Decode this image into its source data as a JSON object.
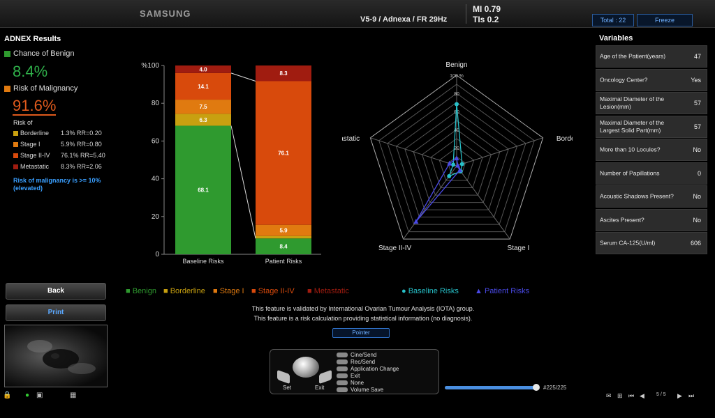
{
  "header": {
    "brand": "SAMSUNG",
    "probe": "V5-9 / Adnexa / FR 29Hz",
    "mi": "MI  0.79",
    "tis": "TIs 0.2",
    "total_label": "Total : 22",
    "freeze_label": "Freeze"
  },
  "colors": {
    "benign": "#2f9a2f",
    "borderline": "#c8a010",
    "stage1": "#e07a10",
    "stage2_4": "#d84a0c",
    "metastatic": "#a01c10",
    "baseline": "#27c0c8",
    "patient": "#4a4ae8"
  },
  "results": {
    "title": "ADNEX Results",
    "benign_label": "Chance of Benign",
    "benign_value": "8.4%",
    "malignancy_label": "Risk of Malignancy",
    "malignancy_value": "91.6%",
    "risk_of_label": "Risk of",
    "risks": [
      {
        "name": "Borderline",
        "value": "1.3% RR=0.20"
      },
      {
        "name": "Stage I",
        "value": "5.9% RR=0.80"
      },
      {
        "name": "Stage II-IV",
        "value": "76.1% RR=5.40"
      },
      {
        "name": "Metastatic",
        "value": "8.3% RR=2.06"
      }
    ],
    "note_line1": "Risk of malignancy is >= 10%",
    "note_line2": "(elevated)"
  },
  "buttons": {
    "back": "Back",
    "print": "Print",
    "pointer": "Pointer"
  },
  "chart_data": [
    {
      "type": "bar",
      "stacked": true,
      "categories": [
        "Baseline Risks",
        "Patient Risks"
      ],
      "ylabel": "%",
      "ylim": [
        0,
        100
      ],
      "yticks": [
        "0",
        "20",
        "40",
        "60",
        "80",
        "%100"
      ],
      "series": [
        {
          "name": "Benign",
          "values": [
            68.1,
            8.4
          ]
        },
        {
          "name": "Borderline",
          "values": [
            6.3,
            1.3
          ]
        },
        {
          "name": "Stage I",
          "values": [
            7.5,
            5.9
          ]
        },
        {
          "name": "Stage II-IV",
          "values": [
            14.1,
            76.1
          ]
        },
        {
          "name": "Metastatic",
          "values": [
            4.0,
            8.3
          ]
        }
      ],
      "data_labels": [
        [
          "68.1",
          "8.4"
        ],
        [
          "6.3",
          ""
        ],
        [
          "7.5",
          "5.9"
        ],
        [
          "14.1",
          "76.1"
        ],
        [
          "4.0",
          "8.3"
        ]
      ],
      "legend": [
        "Benign",
        "Borderline",
        "Stage I",
        "Stage II-IV",
        "Metastatic"
      ]
    },
    {
      "type": "radar",
      "axes": [
        "Benign",
        "Borderline",
        "Stage I",
        "Stage II-IV",
        "Metastatic"
      ],
      "rlim": [
        0,
        100
      ],
      "ring_labels": [
        "20",
        "40",
        "60",
        "80",
        "100 %"
      ],
      "series": [
        {
          "name": "Baseline Risks",
          "values": [
            68.1,
            6.3,
            7.5,
            14.1,
            4.0
          ]
        },
        {
          "name": "Patient Risks",
          "values": [
            8.4,
            1.3,
            5.9,
            76.1,
            8.3
          ]
        }
      ],
      "legend": [
        "Baseline Risks",
        "Patient Risks"
      ]
    }
  ],
  "notes": {
    "line1": "This feature is validated by International Ovarian Tumour Analysis (IOTA) group.",
    "line2": "This feature is a risk calculation providing statistical information (no diagnosis)."
  },
  "control_panel": {
    "set_label": "Set",
    "exit_label": "Exit",
    "commands": [
      "Cine/Send",
      "Rec/Send",
      "Application Change",
      "Exit",
      "None",
      "Volume Save"
    ]
  },
  "cine": {
    "position_text": "#225/225",
    "progress": 1.0,
    "page_text": "5 / 5"
  },
  "variables": {
    "title": "Variables",
    "rows": [
      {
        "label": "Age of the Patient(years)",
        "value": "47"
      },
      {
        "label": "Oncology Center?",
        "value": "Yes"
      },
      {
        "label": "Maximal Diameter of the Lesion(mm)",
        "value": "57"
      },
      {
        "label": "Maximal Diameter of the Largest Solid Part(mm)",
        "value": "57"
      },
      {
        "label": "More than 10 Locules?",
        "value": "No"
      },
      {
        "label": "Number of Papillations",
        "value": "0"
      },
      {
        "label": "Acoustic Shadows Present?",
        "value": "No"
      },
      {
        "label": "Ascites Present?",
        "value": "No"
      },
      {
        "label": "Serum CA-125(U/ml)",
        "value": "606"
      }
    ]
  }
}
